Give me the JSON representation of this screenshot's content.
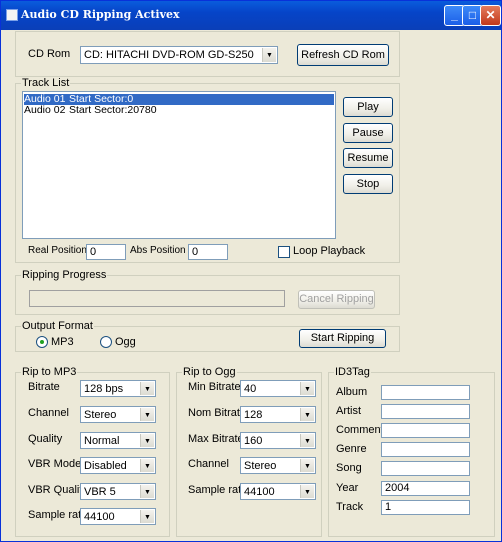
{
  "window": {
    "title": "Audio CD Ripping Activex"
  },
  "cdrom": {
    "label": "CD Rom",
    "selected": "CD: HITACHI DVD-ROM GD-S250",
    "refresh_label": "Refresh CD Rom"
  },
  "track_list": {
    "label": "Track List",
    "tracks": [
      {
        "name": "Audio 01",
        "info": "Start Sector:0"
      },
      {
        "name": "Audio 02",
        "info": "Start Sector:20780"
      }
    ],
    "play_label": "Play",
    "pause_label": "Pause",
    "resume_label": "Resume",
    "stop_label": "Stop",
    "real_position_label": "Real Position",
    "real_position_value": "0",
    "abs_position_label": "Abs Position",
    "abs_position_value": "0",
    "loop_label": "Loop Playback"
  },
  "ripping_progress": {
    "label": "Ripping Progress",
    "cancel_label": "Cancel Ripping",
    "progress": 0
  },
  "output_format": {
    "label": "Output Format",
    "mp3_label": "MP3",
    "ogg_label": "Ogg",
    "selected": "MP3",
    "start_label": "Start Ripping"
  },
  "mp3": {
    "label": "Rip to MP3",
    "bitrate_label": "Bitrate",
    "bitrate": "128 bps",
    "channel_label": "Channel",
    "channel": "Stereo",
    "quality_label": "Quality",
    "quality": "Normal",
    "vbr_mode_label": "VBR Mode",
    "vbr_mode": "Disabled",
    "vbr_quality_label": "VBR Quality",
    "vbr_quality": "VBR 5",
    "sample_rate_label": "Sample rate",
    "sample_rate": "44100"
  },
  "ogg": {
    "label": "Rip to Ogg",
    "min_bitrate_label": "Min Bitrate",
    "min_bitrate": "40",
    "nom_bitrate_label": "Nom Bitrate",
    "nom_bitrate": "128",
    "max_bitrate_label": "Max Bitrate",
    "max_bitrate": "160",
    "channel_label": "Channel",
    "channel": "Stereo",
    "sample_rate_label": "Sample rate",
    "sample_rate": "44100"
  },
  "id3": {
    "label": "ID3Tag",
    "album_label": "Album",
    "album": "",
    "artist_label": "Artist",
    "artist": "",
    "comment_label": "Comment",
    "comment": "",
    "genre_label": "Genre",
    "genre": "",
    "song_label": "Song",
    "song": "",
    "year_label": "Year",
    "year": "2004",
    "track_label": "Track",
    "track": "1"
  }
}
